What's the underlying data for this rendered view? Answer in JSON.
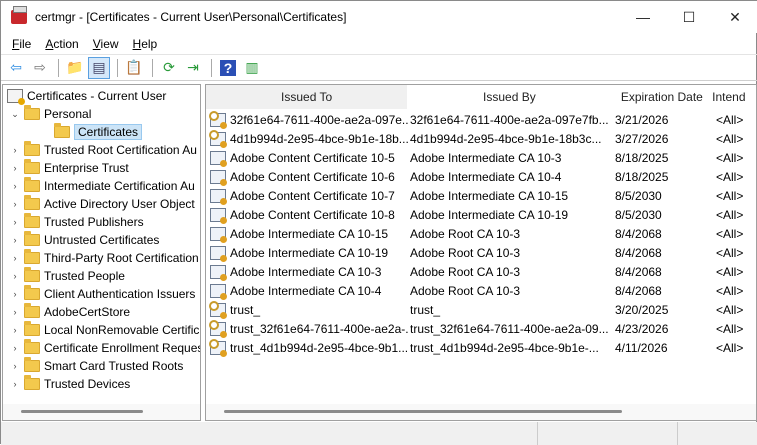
{
  "window": {
    "title": "certmgr - [Certificates - Current User\\Personal\\Certificates]",
    "minimize": "—",
    "maximize": "☐",
    "close": "✕"
  },
  "menu": [
    {
      "label": "File",
      "key": "F",
      "rest": "ile"
    },
    {
      "label": "Action",
      "key": "A",
      "rest": "ction"
    },
    {
      "label": "View",
      "key": "V",
      "rest": "iew"
    },
    {
      "label": "Help",
      "key": "H",
      "rest": "elp"
    }
  ],
  "toolbar": [
    {
      "name": "back-icon",
      "glyph": "⇦",
      "color": "#2a8ae0"
    },
    {
      "name": "forward-icon",
      "glyph": "⇨",
      "color": "#777"
    },
    {
      "sep": true
    },
    {
      "name": "up-folder-icon",
      "glyph": "📁",
      "color": "#d9a830"
    },
    {
      "name": "show-hide-tree-icon",
      "glyph": "▤",
      "color": "#446",
      "active": true
    },
    {
      "sep": true
    },
    {
      "name": "properties-icon",
      "glyph": "📋",
      "color": "#444"
    },
    {
      "sep": true
    },
    {
      "name": "refresh-icon",
      "glyph": "⟳",
      "color": "#2a9a3a"
    },
    {
      "name": "export-list-icon",
      "glyph": "⇥",
      "color": "#2a9a3a"
    },
    {
      "sep": true
    },
    {
      "name": "help-icon",
      "glyph": "?",
      "color": "#fff",
      "bg": "#2b4fb5"
    },
    {
      "name": "action-pane-icon",
      "glyph": "▥",
      "color": "#2a9a3a"
    }
  ],
  "tree": {
    "root": "Certificates - Current User",
    "items": [
      {
        "label": "Personal",
        "level": 1,
        "expanded": true
      },
      {
        "label": "Certificates",
        "level": 2,
        "selected": true
      },
      {
        "label": "Trusted Root Certification Au",
        "level": 1
      },
      {
        "label": "Enterprise Trust",
        "level": 1
      },
      {
        "label": "Intermediate Certification Au",
        "level": 1
      },
      {
        "label": "Active Directory User Object",
        "level": 1
      },
      {
        "label": "Trusted Publishers",
        "level": 1
      },
      {
        "label": "Untrusted Certificates",
        "level": 1
      },
      {
        "label": "Third-Party Root Certification",
        "level": 1
      },
      {
        "label": "Trusted People",
        "level": 1
      },
      {
        "label": "Client Authentication Issuers",
        "level": 1
      },
      {
        "label": "AdobeCertStore",
        "level": 1
      },
      {
        "label": "Local NonRemovable Certific",
        "level": 1
      },
      {
        "label": "Certificate Enrollment Reques",
        "level": 1
      },
      {
        "label": "Smart Card Trusted Roots",
        "level": 1
      },
      {
        "label": "Trusted Devices",
        "level": 1
      }
    ]
  },
  "list": {
    "columns": [
      "Issued To",
      "Issued By",
      "Expiration Date",
      "Intend"
    ],
    "rows": [
      {
        "issued_to": "32f61e64-7611-400e-ae2a-097e...",
        "issued_by": "32f61e64-7611-400e-ae2a-097e7fb...",
        "expires": "3/21/2026",
        "purposes": "<All>",
        "key": true
      },
      {
        "issued_to": "4d1b994d-2e95-4bce-9b1e-18b...",
        "issued_by": "4d1b994d-2e95-4bce-9b1e-18b3c...",
        "expires": "3/27/2026",
        "purposes": "<All>",
        "key": true
      },
      {
        "issued_to": "Adobe Content Certificate 10-5",
        "issued_by": "Adobe Intermediate CA 10-3",
        "expires": "8/18/2025",
        "purposes": "<All>"
      },
      {
        "issued_to": "Adobe Content Certificate 10-6",
        "issued_by": "Adobe Intermediate CA 10-4",
        "expires": "8/18/2025",
        "purposes": "<All>"
      },
      {
        "issued_to": "Adobe Content Certificate 10-7",
        "issued_by": "Adobe Intermediate CA 10-15",
        "expires": "8/5/2030",
        "purposes": "<All>"
      },
      {
        "issued_to": "Adobe Content Certificate 10-8",
        "issued_by": "Adobe Intermediate CA 10-19",
        "expires": "8/5/2030",
        "purposes": "<All>"
      },
      {
        "issued_to": "Adobe Intermediate CA 10-15",
        "issued_by": "Adobe Root CA 10-3",
        "expires": "8/4/2068",
        "purposes": "<All>"
      },
      {
        "issued_to": "Adobe Intermediate CA 10-19",
        "issued_by": "Adobe Root CA 10-3",
        "expires": "8/4/2068",
        "purposes": "<All>"
      },
      {
        "issued_to": "Adobe Intermediate CA 10-3",
        "issued_by": "Adobe Root CA 10-3",
        "expires": "8/4/2068",
        "purposes": "<All>"
      },
      {
        "issued_to": "Adobe Intermediate CA 10-4",
        "issued_by": "Adobe Root CA 10-3",
        "expires": "8/4/2068",
        "purposes": "<All>"
      },
      {
        "issued_to": "trust_",
        "issued_by": "trust_",
        "expires": "3/20/2025",
        "purposes": "<All>",
        "key": true
      },
      {
        "issued_to": "trust_32f61e64-7611-400e-ae2a-...",
        "issued_by": "trust_32f61e64-7611-400e-ae2a-09...",
        "expires": "4/23/2026",
        "purposes": "<All>",
        "key": true
      },
      {
        "issued_to": "trust_4d1b994d-2e95-4bce-9b1...",
        "issued_by": "trust_4d1b994d-2e95-4bce-9b1e-...",
        "expires": "4/11/2026",
        "purposes": "<All>",
        "key": true
      }
    ]
  }
}
